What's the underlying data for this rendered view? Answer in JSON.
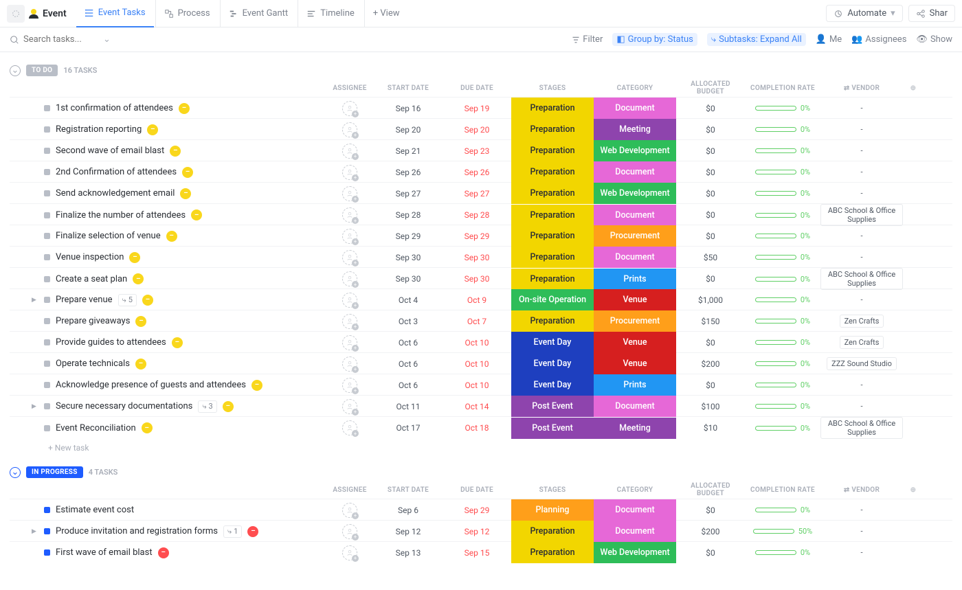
{
  "title": "Event",
  "tabs": [
    {
      "label": "Event Tasks"
    },
    {
      "label": "Process"
    },
    {
      "label": "Event Gantt"
    },
    {
      "label": "Timeline"
    },
    {
      "label": "+ View"
    }
  ],
  "automate": "Automate",
  "share": "Shar",
  "search_placeholder": "Search tasks...",
  "filter": "Filter",
  "groupby": "Group by: Status",
  "subtasks": "Subtasks: Expand All",
  "me": "Me",
  "assignees": "Assignees",
  "show": "Show",
  "columns": [
    "ASSIGNEE",
    "START DATE",
    "DUE DATE",
    "STAGES",
    "CATEGORY",
    "ALLOCATED BUDGET",
    "COMPLETION RATE",
    "VENDOR"
  ],
  "vendor_icon_label": "⇄",
  "groups": [
    {
      "name": "TO DO",
      "pill_class": "pill-todo",
      "count": "16 TASKS",
      "collapse_class": "",
      "tasks": [
        {
          "sq": "sq-todo",
          "name": "1st confirmation of attendees",
          "badge": "y",
          "start": "Sep 16",
          "due": "Sep 19",
          "stage": "Preparation",
          "stage_c": "c-prep",
          "cat": "Document",
          "cat_c": "c-doc",
          "budget": "$0",
          "pct": 0,
          "vendor": "-"
        },
        {
          "sq": "sq-todo",
          "name": "Registration reporting",
          "badge": "y",
          "start": "Sep 20",
          "due": "Sep 20",
          "stage": "Preparation",
          "stage_c": "c-prep",
          "cat": "Meeting",
          "cat_c": "c-meet",
          "budget": "$0",
          "pct": 0,
          "vendor": "-"
        },
        {
          "sq": "sq-todo",
          "name": "Second wave of email blast",
          "badge": "y",
          "start": "Sep 21",
          "due": "Sep 23",
          "stage": "Preparation",
          "stage_c": "c-prep",
          "cat": "Web Development",
          "cat_c": "c-web",
          "budget": "$0",
          "pct": 0,
          "vendor": "-"
        },
        {
          "sq": "sq-todo",
          "name": "2nd Confirmation of attendees",
          "badge": "y",
          "start": "Sep 26",
          "due": "Sep 26",
          "stage": "Preparation",
          "stage_c": "c-prep",
          "cat": "Document",
          "cat_c": "c-doc",
          "budget": "$0",
          "pct": 0,
          "vendor": "-"
        },
        {
          "sq": "sq-todo",
          "name": "Send acknowledgement email",
          "badge": "y",
          "start": "Sep 27",
          "due": "Sep 27",
          "stage": "Preparation",
          "stage_c": "c-prep",
          "cat": "Web Development",
          "cat_c": "c-web",
          "budget": "$0",
          "pct": 0,
          "vendor": "-"
        },
        {
          "sq": "sq-todo",
          "name": "Finalize the number of attendees",
          "badge": "y",
          "start": "Sep 28",
          "due": "Sep 28",
          "stage": "Preparation",
          "stage_c": "c-prep",
          "cat": "Document",
          "cat_c": "c-doc",
          "budget": "$0",
          "pct": 0,
          "vendor": "ABC School & Office Supplies"
        },
        {
          "sq": "sq-todo",
          "name": "Finalize selection of venue",
          "badge": "y",
          "start": "Sep 29",
          "due": "Sep 29",
          "stage": "Preparation",
          "stage_c": "c-prep",
          "cat": "Procurement",
          "cat_c": "c-proc",
          "budget": "$0",
          "pct": 0,
          "vendor": "-"
        },
        {
          "sq": "sq-todo",
          "name": "Venue inspection",
          "badge": "y",
          "start": "Sep 30",
          "due": "Sep 30",
          "stage": "Preparation",
          "stage_c": "c-prep",
          "cat": "Document",
          "cat_c": "c-doc",
          "budget": "$50",
          "pct": 0,
          "vendor": "-"
        },
        {
          "sq": "sq-todo",
          "name": "Create a seat plan",
          "badge": "y",
          "start": "Sep 30",
          "due": "Sep 30",
          "stage": "Preparation",
          "stage_c": "c-prep",
          "cat": "Prints",
          "cat_c": "c-prints",
          "budget": "$0",
          "pct": 0,
          "vendor": "ABC School & Office Supplies"
        },
        {
          "sq": "sq-todo",
          "name": "Prepare venue",
          "badge": "y",
          "sub": "5",
          "expand": true,
          "start": "Oct 4",
          "due": "Oct 9",
          "stage": "On-site Operation",
          "stage_c": "c-onsite",
          "cat": "Venue",
          "cat_c": "c-venue",
          "budget": "$1,000",
          "pct": 0,
          "vendor": "-"
        },
        {
          "sq": "sq-todo",
          "name": "Prepare giveaways",
          "badge": "y",
          "start": "Oct 3",
          "due": "Oct 7",
          "stage": "Preparation",
          "stage_c": "c-prep",
          "cat": "Procurement",
          "cat_c": "c-proc",
          "budget": "$150",
          "pct": 0,
          "vendor": "Zen Crafts"
        },
        {
          "sq": "sq-todo",
          "name": "Provide guides to attendees",
          "badge": "y",
          "start": "Oct 6",
          "due": "Oct 10",
          "stage": "Event Day",
          "stage_c": "c-eventday",
          "cat": "Venue",
          "cat_c": "c-venue",
          "budget": "$0",
          "pct": 0,
          "vendor": "Zen Crafts"
        },
        {
          "sq": "sq-todo",
          "name": "Operate technicals",
          "badge": "y",
          "start": "Oct 6",
          "due": "Oct 10",
          "stage": "Event Day",
          "stage_c": "c-eventday",
          "cat": "Venue",
          "cat_c": "c-venue",
          "budget": "$200",
          "pct": 0,
          "vendor": "ZZZ Sound Studio"
        },
        {
          "sq": "sq-todo",
          "name": "Acknowledge presence of guests and attendees",
          "badge": "y",
          "start": "Oct 6",
          "due": "Oct 10",
          "stage": "Event Day",
          "stage_c": "c-eventday",
          "cat": "Prints",
          "cat_c": "c-prints",
          "budget": "$0",
          "pct": 0,
          "vendor": "-"
        },
        {
          "sq": "sq-todo",
          "name": "Secure necessary documentations",
          "badge": "y",
          "sub": "3",
          "expand": true,
          "start": "Oct 11",
          "due": "Oct 14",
          "stage": "Post Event",
          "stage_c": "c-post",
          "cat": "Document",
          "cat_c": "c-doc",
          "budget": "$100",
          "pct": 0,
          "vendor": "-"
        },
        {
          "sq": "sq-todo",
          "name": "Event Reconciliation",
          "badge": "y",
          "start": "Oct 17",
          "due": "Oct 18",
          "stage": "Post Event",
          "stage_c": "c-post",
          "cat": "Meeting",
          "cat_c": "c-meet",
          "budget": "$10",
          "pct": 0,
          "vendor": "ABC School & Office Supplies"
        }
      ],
      "newtask": "+ New task"
    },
    {
      "name": "IN PROGRESS",
      "pill_class": "pill-inprogress",
      "count": "4 TASKS",
      "collapse_class": "ip",
      "tasks": [
        {
          "sq": "sq-ip",
          "name": "Estimate event cost",
          "badge": null,
          "start": "Sep 6",
          "due": "Sep 29",
          "stage": "Planning",
          "stage_c": "c-plan",
          "cat": "Document",
          "cat_c": "c-doc",
          "budget": "$0",
          "pct": 0,
          "vendor": "-"
        },
        {
          "sq": "sq-ip",
          "name": "Produce invitation and registration forms",
          "badge": "r",
          "sub": "1",
          "expand": true,
          "start": "Sep 12",
          "due": "Sep 12",
          "stage": "Preparation",
          "stage_c": "c-prep",
          "cat": "Document",
          "cat_c": "c-doc",
          "budget": "$200",
          "pct": 50,
          "vendor": "-"
        },
        {
          "sq": "sq-ip",
          "name": "First wave of email blast",
          "badge": "r",
          "start": "Sep 13",
          "due": "Sep 15",
          "stage": "Preparation",
          "stage_c": "c-prep",
          "cat": "Web Development",
          "cat_c": "c-web",
          "budget": "$0",
          "pct": 0,
          "vendor": "-"
        }
      ]
    }
  ]
}
